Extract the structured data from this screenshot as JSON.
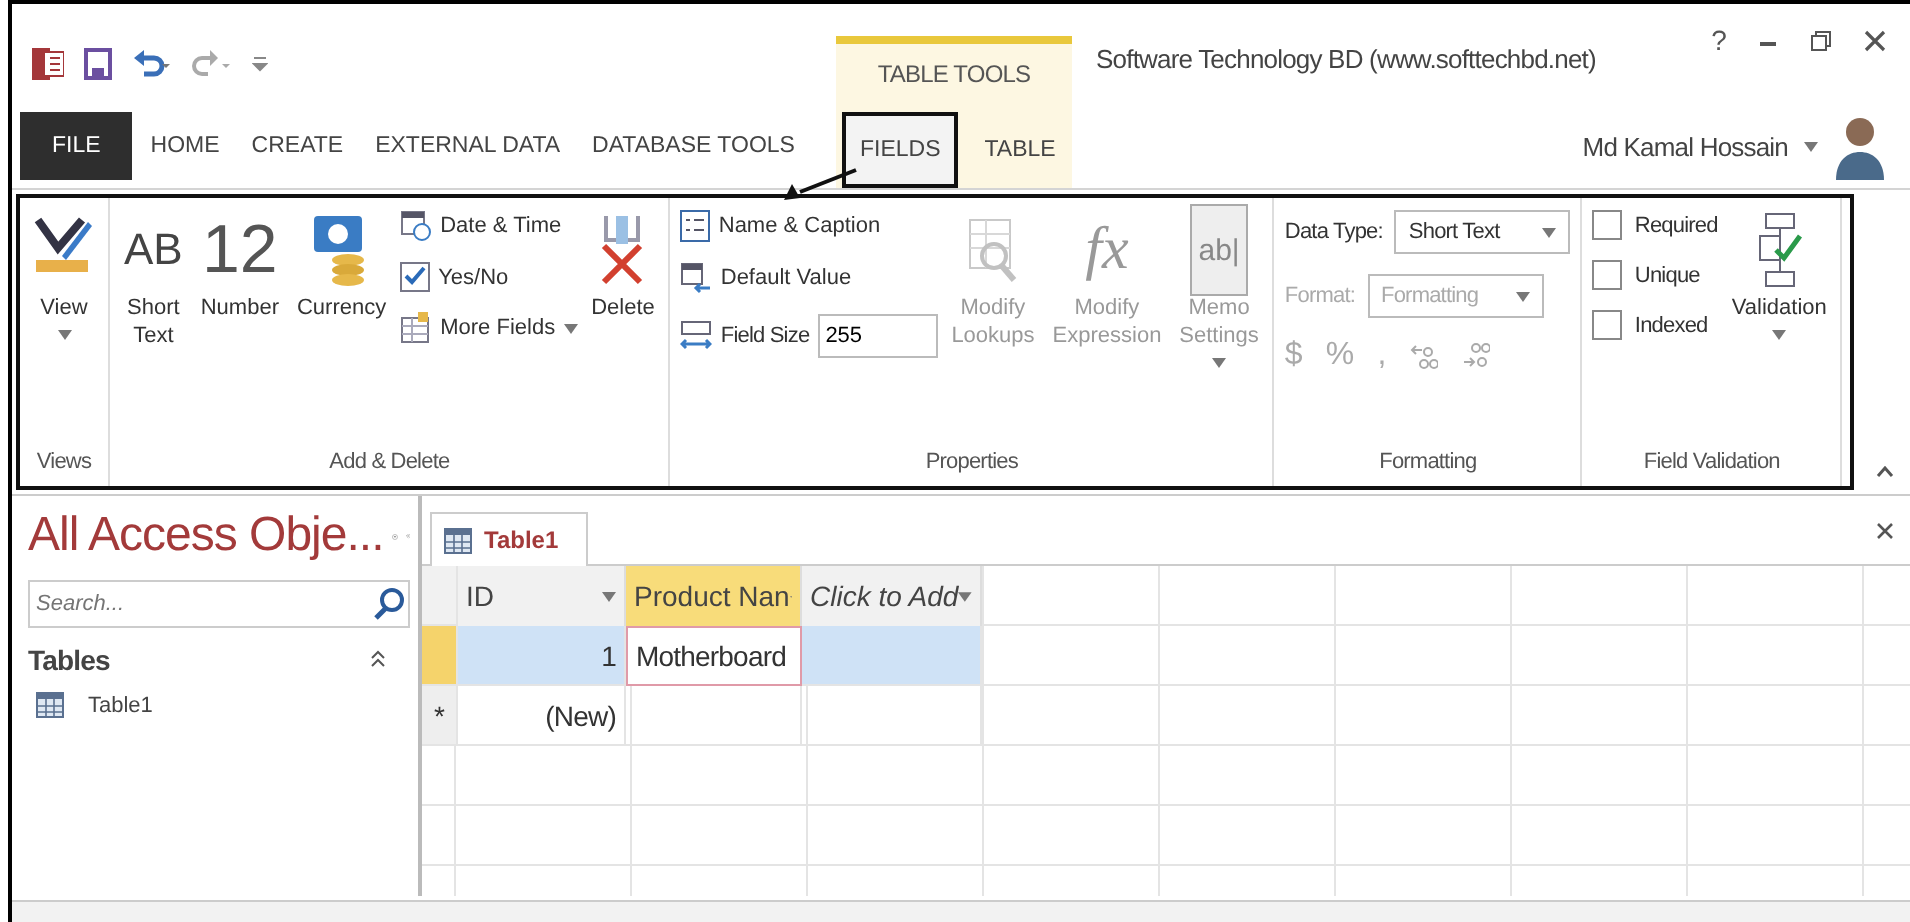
{
  "context_group": {
    "label": "TABLE TOOLS"
  },
  "window": {
    "title": "Software Technology BD (www.softtechbd.net)",
    "help": "?"
  },
  "user": {
    "name": "Md Kamal Hossain"
  },
  "tabs": [
    {
      "label": "FILE",
      "kind": "file",
      "selected": false
    },
    {
      "label": "HOME",
      "kind": "normal",
      "selected": false
    },
    {
      "label": "CREATE",
      "kind": "normal",
      "selected": false
    },
    {
      "label": "EXTERNAL DATA",
      "kind": "normal",
      "selected": false
    },
    {
      "label": "DATABASE TOOLS",
      "kind": "normal",
      "selected": false
    },
    {
      "label": "FIELDS",
      "kind": "contextual",
      "selected": true
    },
    {
      "label": "TABLE",
      "kind": "contextual",
      "selected": false
    }
  ],
  "ribbon": {
    "groups": [
      {
        "label": "Views",
        "columns": [
          {
            "kind": "large",
            "label": "View",
            "dropdown": true,
            "disabled": false
          }
        ]
      },
      {
        "label": "Add & Delete",
        "columns": [
          {
            "kind": "large",
            "glyph": "AB",
            "label": "Short Text",
            "dropdown": false,
            "disabled": false
          },
          {
            "kind": "large",
            "glyph": "12",
            "label": "Number",
            "dropdown": false,
            "disabled": false
          },
          {
            "kind": "large",
            "label": "Currency",
            "dropdown": false,
            "disabled": false
          },
          {
            "kind": "stack",
            "items": [
              {
                "kind": "small",
                "label": "Date & Time",
                "dropdown": false
              },
              {
                "kind": "small",
                "label": "Yes/No",
                "dropdown": false
              },
              {
                "kind": "small",
                "label": "More Fields",
                "dropdown": true
              }
            ]
          },
          {
            "kind": "large",
            "label": "Delete",
            "dropdown": false,
            "disabled": false
          }
        ]
      },
      {
        "label": "Properties",
        "columns": [
          {
            "kind": "stack",
            "items": [
              {
                "kind": "small",
                "label": "Name & Caption",
                "dropdown": false
              },
              {
                "kind": "small",
                "label": "Default Value",
                "dropdown": false
              },
              {
                "kind": "field",
                "label": "Field Size",
                "value": "255"
              }
            ]
          },
          {
            "kind": "large",
            "label": "Modify Lookups",
            "dropdown": false,
            "disabled": true
          },
          {
            "kind": "large",
            "glyph": "fx",
            "label": "Modify Expression",
            "dropdown": false,
            "disabled": true
          },
          {
            "kind": "large",
            "glyph": "ab|",
            "label": "Memo Settings",
            "dropdown": true,
            "disabled": true
          }
        ]
      },
      {
        "label": "Formatting",
        "columns": [
          {
            "kind": "stack",
            "items": [
              {
                "kind": "select",
                "label": "Data Type:",
                "value": "Short Text",
                "disabled": false
              },
              {
                "kind": "select",
                "label": "Format:",
                "value": "Formatting",
                "disabled": true
              },
              {
                "kind": "symbols",
                "glyphs": [
                  "$",
                  "%",
                  ","
                ],
                "disabled": true
              }
            ]
          }
        ]
      },
      {
        "label": "Field Validation",
        "columns": [
          {
            "kind": "stack",
            "items": [
              {
                "kind": "check",
                "label": "Required",
                "checked": false
              },
              {
                "kind": "check",
                "label": "Unique",
                "checked": false
              },
              {
                "kind": "check",
                "label": "Indexed",
                "checked": false
              }
            ]
          },
          {
            "kind": "large",
            "label": "Validation",
            "dropdown": true,
            "disabled": false
          }
        ]
      }
    ]
  },
  "navigation": {
    "title": "All Access Obje...",
    "search": {
      "placeholder": "Search..."
    },
    "section": "Tables",
    "items": [
      {
        "label": "Table1"
      }
    ]
  },
  "document_tabs": [
    {
      "label": "Table1",
      "selected": true
    }
  ],
  "datasheet": {
    "columns": [
      {
        "label": "ID",
        "kind": "field",
        "selected": false
      },
      {
        "label": "Product Nan",
        "kind": "field",
        "selected": true
      },
      {
        "label": "Click to Add",
        "kind": "add",
        "selected": false
      }
    ],
    "rows": [
      {
        "kind": "record",
        "selected": true,
        "cells": [
          {
            "text": "1",
            "active": false
          },
          {
            "text": "Motherboard",
            "active": true
          },
          {
            "text": "",
            "active": false
          }
        ]
      },
      {
        "kind": "new",
        "marker": "*",
        "selected": false,
        "cells": [
          {
            "text": "(New)",
            "active": false
          },
          {
            "text": "",
            "active": false
          },
          {
            "text": "",
            "active": false
          }
        ]
      }
    ]
  }
}
